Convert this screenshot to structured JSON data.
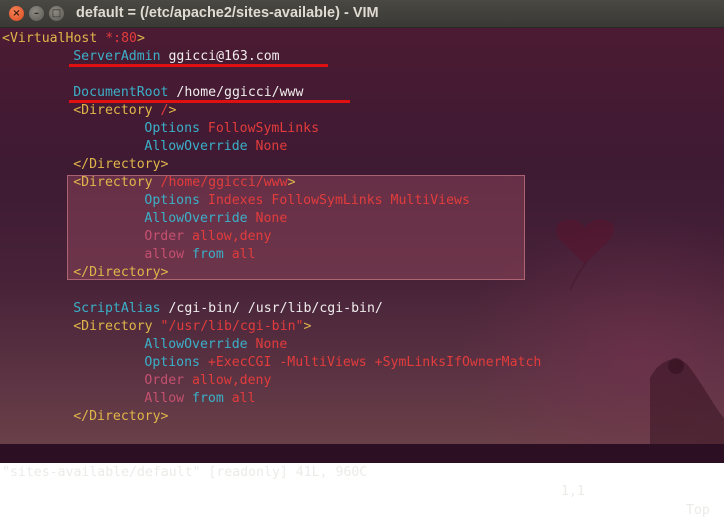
{
  "window": {
    "title": "default = (/etc/apache2/sites-available) - VIM",
    "close_glyph": "×",
    "min_glyph": "–",
    "max_glyph": "□"
  },
  "editor": {
    "lines": [
      {
        "row": 0,
        "indent": 0,
        "segments": [
          {
            "t": "<",
            "c": "tag"
          },
          {
            "t": "VirtualHost",
            "c": "tag"
          },
          {
            "t": " *:80",
            "c": "red"
          },
          {
            "t": ">",
            "c": "tag"
          }
        ]
      },
      {
        "row": 1,
        "indent": 8,
        "segments": [
          {
            "t": "ServerAdmin",
            "c": "cyn"
          },
          {
            "t": " ggicci@163.com",
            "c": "wht"
          }
        ]
      },
      {
        "row": 2,
        "indent": 0,
        "segments": []
      },
      {
        "row": 3,
        "indent": 8,
        "segments": [
          {
            "t": "DocumentRoot",
            "c": "cyn"
          },
          {
            "t": " /home/ggicci/www",
            "c": "wht"
          }
        ]
      },
      {
        "row": 4,
        "indent": 8,
        "segments": [
          {
            "t": "<Directory",
            "c": "tag"
          },
          {
            "t": " /",
            "c": "red"
          },
          {
            "t": ">",
            "c": "tag"
          }
        ]
      },
      {
        "row": 5,
        "indent": 16,
        "segments": [
          {
            "t": "Options",
            "c": "cyn"
          },
          {
            "t": " FollowSymLinks",
            "c": "red"
          }
        ]
      },
      {
        "row": 6,
        "indent": 16,
        "segments": [
          {
            "t": "AllowOverride",
            "c": "cyn"
          },
          {
            "t": " None",
            "c": "red"
          }
        ]
      },
      {
        "row": 7,
        "indent": 8,
        "segments": [
          {
            "t": "</Directory>",
            "c": "tag"
          }
        ]
      },
      {
        "row": 8,
        "indent": 8,
        "segments": [
          {
            "t": "<Directory",
            "c": "tag"
          },
          {
            "t": " /home/ggicci/www",
            "c": "red"
          },
          {
            "t": ">",
            "c": "tag"
          }
        ]
      },
      {
        "row": 9,
        "indent": 16,
        "segments": [
          {
            "t": "Options",
            "c": "cyn"
          },
          {
            "t": " Indexes FollowSymLinks MultiViews",
            "c": "red"
          }
        ]
      },
      {
        "row": 10,
        "indent": 16,
        "segments": [
          {
            "t": "AllowOverride",
            "c": "cyn"
          },
          {
            "t": " None",
            "c": "red"
          }
        ]
      },
      {
        "row": 11,
        "indent": 16,
        "segments": [
          {
            "t": "Order",
            "c": "dim"
          },
          {
            "t": " allow,deny",
            "c": "red"
          }
        ]
      },
      {
        "row": 12,
        "indent": 16,
        "segments": [
          {
            "t": "allow",
            "c": "dim"
          },
          {
            "t": " from",
            "c": "cyn"
          },
          {
            "t": " all",
            "c": "red"
          }
        ]
      },
      {
        "row": 13,
        "indent": 8,
        "segments": [
          {
            "t": "</Directory>",
            "c": "tag"
          }
        ]
      },
      {
        "row": 14,
        "indent": 0,
        "segments": []
      },
      {
        "row": 15,
        "indent": 8,
        "segments": [
          {
            "t": "ScriptAlias",
            "c": "cyn"
          },
          {
            "t": " /cgi-bin/ /usr/lib/cgi-bin/",
            "c": "wht"
          }
        ]
      },
      {
        "row": 16,
        "indent": 8,
        "segments": [
          {
            "t": "<Directory",
            "c": "tag"
          },
          {
            "t": " \"/usr/lib/cgi-bin\"",
            "c": "red"
          },
          {
            "t": ">",
            "c": "tag"
          }
        ]
      },
      {
        "row": 17,
        "indent": 16,
        "segments": [
          {
            "t": "AllowOverride",
            "c": "cyn"
          },
          {
            "t": " None",
            "c": "red"
          }
        ]
      },
      {
        "row": 18,
        "indent": 16,
        "segments": [
          {
            "t": "Options",
            "c": "cyn"
          },
          {
            "t": " +ExecCGI -MultiViews +SymLinksIfOwnerMatch",
            "c": "red"
          }
        ]
      },
      {
        "row": 19,
        "indent": 16,
        "segments": [
          {
            "t": "Order",
            "c": "dim"
          },
          {
            "t": " allow,deny",
            "c": "red"
          }
        ]
      },
      {
        "row": 20,
        "indent": 16,
        "segments": [
          {
            "t": "Allow",
            "c": "dim"
          },
          {
            "t": " from",
            "c": "cyn"
          },
          {
            "t": " all",
            "c": "red"
          }
        ]
      },
      {
        "row": 21,
        "indent": 8,
        "segments": [
          {
            "t": "</Directory>",
            "c": "tag"
          }
        ]
      }
    ]
  },
  "statusbar": {
    "file_info": "\"sites-available/default\" [readonly] 41L, 960C",
    "cursor_pos": "1,1",
    "scroll_pos": "Top"
  },
  "colors": {
    "underline": "#e01010",
    "highlight_box": "#b45a6e"
  }
}
